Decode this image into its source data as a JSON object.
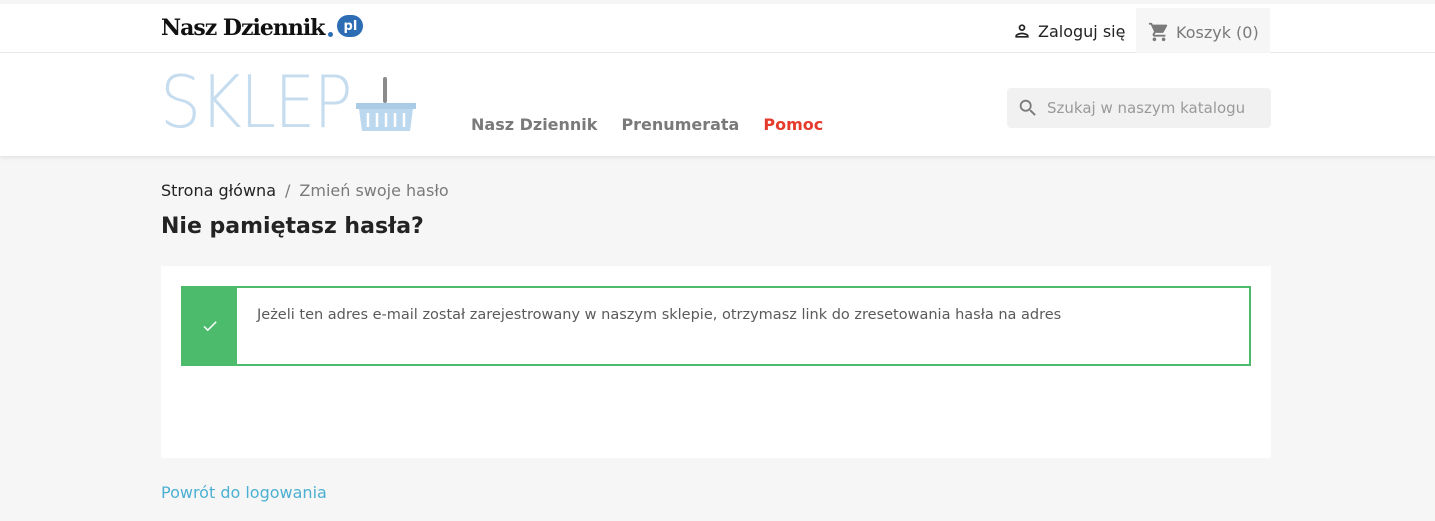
{
  "topbar": {
    "brand_text": "Nasz Dziennik",
    "brand_badge": "pl",
    "login_label": "Zaloguj się",
    "cart_label": "Koszyk (0)"
  },
  "header": {
    "logo_text": "SKLEP",
    "nav": [
      {
        "label": "Nasz Dziennik"
      },
      {
        "label": "Prenumerata"
      },
      {
        "label": "Pomoc"
      }
    ],
    "search_placeholder": "Szukaj w naszym katalogu"
  },
  "breadcrumb": {
    "home": "Strona główna",
    "separator": "/",
    "current": "Zmień swoje hasło"
  },
  "page_title": "Nie pamiętasz hasła?",
  "alert": {
    "message": "Jeżeli ten adres e-mail został zarejestrowany w naszym sklepie, otrzymasz link do zresetowania hasła na adres",
    "icon": "check-icon",
    "color": "#4cbb6c"
  },
  "back_link": "Powrót do logowania",
  "colors": {
    "accent_red": "#e53b2c",
    "link_blue": "#4bb0d2",
    "success_green": "#4cbb6c"
  }
}
